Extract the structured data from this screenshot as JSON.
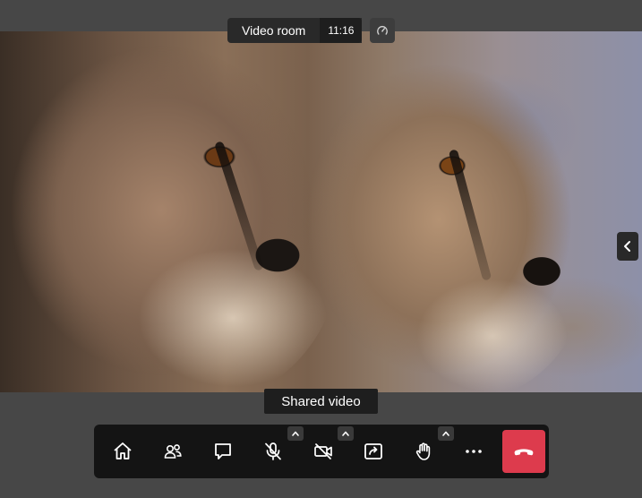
{
  "header": {
    "room_title": "Video room",
    "time": "11:16",
    "connection_icon": "speedometer-icon"
  },
  "video": {
    "label": "Shared video"
  },
  "toolbar": {
    "buttons": [
      {
        "icon": "home-icon",
        "has_options": false
      },
      {
        "icon": "participants-icon",
        "has_options": false
      },
      {
        "icon": "chat-icon",
        "has_options": false
      },
      {
        "icon": "microphone-muted-icon",
        "has_options": true
      },
      {
        "icon": "camera-off-icon",
        "has_options": true
      },
      {
        "icon": "share-screen-icon",
        "has_options": false
      },
      {
        "icon": "raise-hand-icon",
        "has_options": true
      },
      {
        "icon": "more-options-icon",
        "has_options": false
      },
      {
        "icon": "hang-up-icon",
        "has_options": false
      }
    ],
    "hangup_color": "#dd3b4d"
  },
  "side_toggle_icon": "chevron-left-icon"
}
